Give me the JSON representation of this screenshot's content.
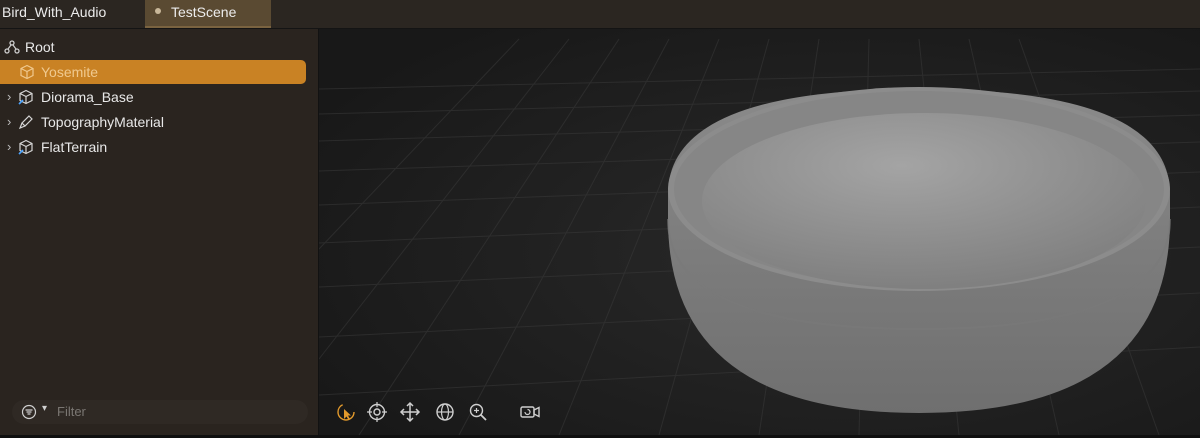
{
  "tabs": [
    {
      "label": "Bird_With_Audio"
    },
    {
      "label": "TestScene"
    }
  ],
  "hierarchy": {
    "root_label": "Root",
    "selected_label": "Yosemite",
    "children": [
      {
        "label": "Diorama_Base",
        "icon": "entity-icon"
      },
      {
        "label": "TopographyMaterial",
        "icon": "material-icon"
      },
      {
        "label": "FlatTerrain",
        "icon": "entity-icon"
      }
    ]
  },
  "filter": {
    "placeholder": "Filter"
  },
  "viewport_toolbar": [
    {
      "name": "select-tool-icon",
      "active": true
    },
    {
      "name": "orbit-tool-icon",
      "active": false
    },
    {
      "name": "move-tool-icon",
      "active": false
    },
    {
      "name": "globe-tool-icon",
      "active": false
    },
    {
      "name": "zoom-tool-icon",
      "active": false
    },
    {
      "name": "camera-tool-icon",
      "active": false
    }
  ],
  "colors": {
    "accent": "#c98224",
    "selected_text": "#f0c98f",
    "tab_active": "#5a4a32",
    "sidebar_bg": "#2a241f",
    "viewport_bg": "#1b1b1b"
  }
}
